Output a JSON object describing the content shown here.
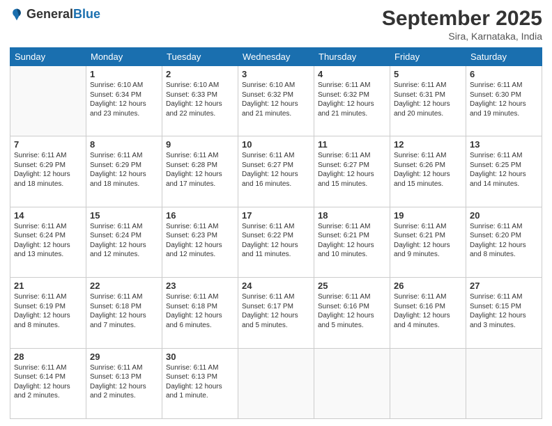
{
  "header": {
    "logo_general": "General",
    "logo_blue": "Blue",
    "month_title": "September 2025",
    "location": "Sira, Karnataka, India"
  },
  "days_of_week": [
    "Sunday",
    "Monday",
    "Tuesday",
    "Wednesday",
    "Thursday",
    "Friday",
    "Saturday"
  ],
  "weeks": [
    [
      {
        "day": "",
        "info": ""
      },
      {
        "day": "1",
        "info": "Sunrise: 6:10 AM\nSunset: 6:34 PM\nDaylight: 12 hours\nand 23 minutes."
      },
      {
        "day": "2",
        "info": "Sunrise: 6:10 AM\nSunset: 6:33 PM\nDaylight: 12 hours\nand 22 minutes."
      },
      {
        "day": "3",
        "info": "Sunrise: 6:10 AM\nSunset: 6:32 PM\nDaylight: 12 hours\nand 21 minutes."
      },
      {
        "day": "4",
        "info": "Sunrise: 6:11 AM\nSunset: 6:32 PM\nDaylight: 12 hours\nand 21 minutes."
      },
      {
        "day": "5",
        "info": "Sunrise: 6:11 AM\nSunset: 6:31 PM\nDaylight: 12 hours\nand 20 minutes."
      },
      {
        "day": "6",
        "info": "Sunrise: 6:11 AM\nSunset: 6:30 PM\nDaylight: 12 hours\nand 19 minutes."
      }
    ],
    [
      {
        "day": "7",
        "info": "Sunrise: 6:11 AM\nSunset: 6:29 PM\nDaylight: 12 hours\nand 18 minutes."
      },
      {
        "day": "8",
        "info": "Sunrise: 6:11 AM\nSunset: 6:29 PM\nDaylight: 12 hours\nand 18 minutes."
      },
      {
        "day": "9",
        "info": "Sunrise: 6:11 AM\nSunset: 6:28 PM\nDaylight: 12 hours\nand 17 minutes."
      },
      {
        "day": "10",
        "info": "Sunrise: 6:11 AM\nSunset: 6:27 PM\nDaylight: 12 hours\nand 16 minutes."
      },
      {
        "day": "11",
        "info": "Sunrise: 6:11 AM\nSunset: 6:27 PM\nDaylight: 12 hours\nand 15 minutes."
      },
      {
        "day": "12",
        "info": "Sunrise: 6:11 AM\nSunset: 6:26 PM\nDaylight: 12 hours\nand 15 minutes."
      },
      {
        "day": "13",
        "info": "Sunrise: 6:11 AM\nSunset: 6:25 PM\nDaylight: 12 hours\nand 14 minutes."
      }
    ],
    [
      {
        "day": "14",
        "info": "Sunrise: 6:11 AM\nSunset: 6:24 PM\nDaylight: 12 hours\nand 13 minutes."
      },
      {
        "day": "15",
        "info": "Sunrise: 6:11 AM\nSunset: 6:24 PM\nDaylight: 12 hours\nand 12 minutes."
      },
      {
        "day": "16",
        "info": "Sunrise: 6:11 AM\nSunset: 6:23 PM\nDaylight: 12 hours\nand 12 minutes."
      },
      {
        "day": "17",
        "info": "Sunrise: 6:11 AM\nSunset: 6:22 PM\nDaylight: 12 hours\nand 11 minutes."
      },
      {
        "day": "18",
        "info": "Sunrise: 6:11 AM\nSunset: 6:21 PM\nDaylight: 12 hours\nand 10 minutes."
      },
      {
        "day": "19",
        "info": "Sunrise: 6:11 AM\nSunset: 6:21 PM\nDaylight: 12 hours\nand 9 minutes."
      },
      {
        "day": "20",
        "info": "Sunrise: 6:11 AM\nSunset: 6:20 PM\nDaylight: 12 hours\nand 8 minutes."
      }
    ],
    [
      {
        "day": "21",
        "info": "Sunrise: 6:11 AM\nSunset: 6:19 PM\nDaylight: 12 hours\nand 8 minutes."
      },
      {
        "day": "22",
        "info": "Sunrise: 6:11 AM\nSunset: 6:18 PM\nDaylight: 12 hours\nand 7 minutes."
      },
      {
        "day": "23",
        "info": "Sunrise: 6:11 AM\nSunset: 6:18 PM\nDaylight: 12 hours\nand 6 minutes."
      },
      {
        "day": "24",
        "info": "Sunrise: 6:11 AM\nSunset: 6:17 PM\nDaylight: 12 hours\nand 5 minutes."
      },
      {
        "day": "25",
        "info": "Sunrise: 6:11 AM\nSunset: 6:16 PM\nDaylight: 12 hours\nand 5 minutes."
      },
      {
        "day": "26",
        "info": "Sunrise: 6:11 AM\nSunset: 6:16 PM\nDaylight: 12 hours\nand 4 minutes."
      },
      {
        "day": "27",
        "info": "Sunrise: 6:11 AM\nSunset: 6:15 PM\nDaylight: 12 hours\nand 3 minutes."
      }
    ],
    [
      {
        "day": "28",
        "info": "Sunrise: 6:11 AM\nSunset: 6:14 PM\nDaylight: 12 hours\nand 2 minutes."
      },
      {
        "day": "29",
        "info": "Sunrise: 6:11 AM\nSunset: 6:13 PM\nDaylight: 12 hours\nand 2 minutes."
      },
      {
        "day": "30",
        "info": "Sunrise: 6:11 AM\nSunset: 6:13 PM\nDaylight: 12 hours\nand 1 minute."
      },
      {
        "day": "",
        "info": ""
      },
      {
        "day": "",
        "info": ""
      },
      {
        "day": "",
        "info": ""
      },
      {
        "day": "",
        "info": ""
      }
    ]
  ]
}
